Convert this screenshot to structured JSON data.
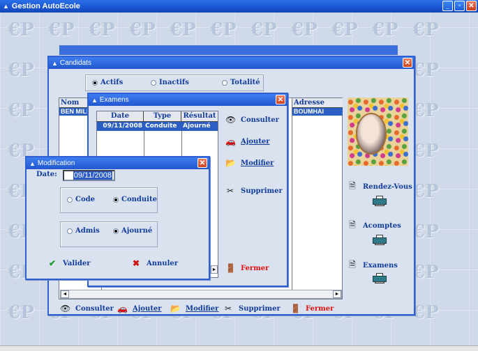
{
  "app": {
    "title": "Gestion AutoEcole",
    "watermark": "€P"
  },
  "candidats": {
    "title": "Candidats",
    "filters": [
      {
        "label": "Actifs",
        "checked": true
      },
      {
        "label": "Inactifs",
        "checked": false
      },
      {
        "label": "Totalité",
        "checked": false
      }
    ],
    "columns": {
      "nom": "Nom",
      "adresse": "Adresse"
    },
    "row": {
      "nom": "BEN MILE",
      "adresse": "BOUMHAI"
    },
    "sidebar": {
      "rendez_vous": "Rendez-Vous",
      "acomptes": "Acomptes",
      "examens": "Examens"
    },
    "toolbar": {
      "consulter": "Consulter",
      "ajouter": "Ajouter",
      "modifier": "Modifier",
      "supprimer": "Supprimer",
      "fermer": "Fermer"
    }
  },
  "examens": {
    "title": "Examens",
    "columns": [
      "Date",
      "Type",
      "Résultat"
    ],
    "rows": [
      {
        "date": "09/11/2008",
        "type": "Conduite",
        "resultat": "Ajourné"
      }
    ],
    "actions": {
      "consulter": "Consulter",
      "ajouter": "Ajouter",
      "modifier": "Modifier",
      "supprimer": "Supprimer",
      "fermer": "Fermer"
    }
  },
  "modification": {
    "title": "Modification",
    "date_label": "Date:",
    "date_value": "09/11/2008",
    "type_options": [
      {
        "label": "Code",
        "checked": false
      },
      {
        "label": "Conduite",
        "checked": true
      }
    ],
    "result_options": [
      {
        "label": "Admis",
        "checked": false
      },
      {
        "label": "Ajourné",
        "checked": true
      }
    ],
    "valider": "Valider",
    "annuler": "Annuler"
  },
  "colors": {
    "title_bar": "#1a55d0",
    "selection": "#2b5fc4",
    "text_blue": "#123c9c",
    "fermer_red": "#e01010"
  }
}
